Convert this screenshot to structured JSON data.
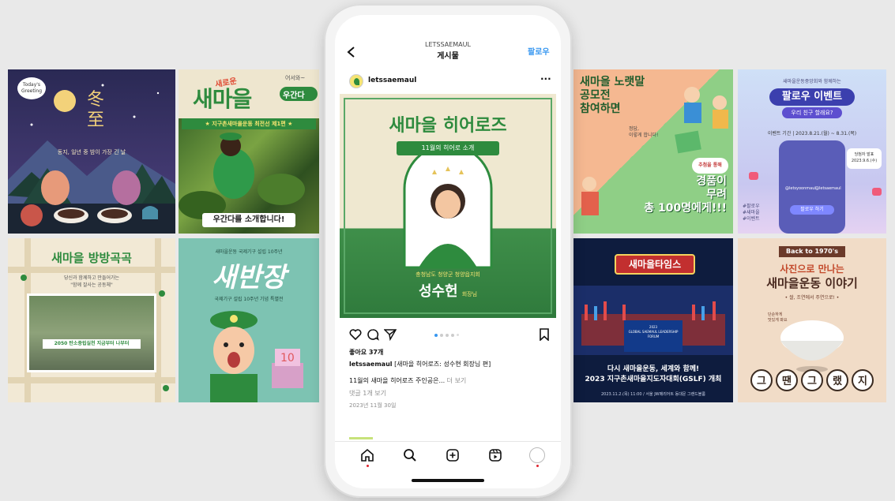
{
  "left_tiles": {
    "winter": {
      "badge": "Today's\nGreeting",
      "title": "冬\n至",
      "sub": "동지, 일년 중 밤이 가장 긴 날"
    },
    "woogan": {
      "sign": "어서와~",
      "title": "새마을",
      "badge": "우간다",
      "tag": "새로운",
      "ribbon": "★ 지구촌새마을운동 최전선 제1편 ★",
      "bottom": "우간다를 소개합니다!"
    },
    "bangbang": {
      "title": "새마을 방방곡곡",
      "sub": "당신과 함께하고 만들어가는\n\"함께 잘사는 공동체\"",
      "banner": "2050 탄소중립실천 지금부터 나부터"
    },
    "market": {
      "top": "새마을운동 국제기구 설립 10주년",
      "title": "새반장",
      "sub": "국제기구 설립 10주년 기념 특별전"
    }
  },
  "right_tiles": {
    "contest": {
      "title": "새마을 노랫말\n공모전\n참여하면",
      "sub": "정답,\n이렇게 합니다!",
      "badge": "추첨을 통해",
      "prize": "경품이\n무려\n총 100명에게!!!"
    },
    "follow": {
      "top": "새마을운동중앙회와 함께하는",
      "title": "팔로우 이벤트",
      "sub": "우리 친구 할래요?",
      "period": "이벤트 기간 | 2023.8.21.(월) ~ 8.31.(목)",
      "announce": "당첨자 발표\n2023.9.6.(수)",
      "handle1": "@letsyoonmaul",
      "handle2": "@letsaemaul",
      "follow_btn": "팔로우 하기",
      "hashtags": "#팔로우\n#새마을\n#이벤트"
    },
    "times": {
      "title": "새마을타임스",
      "forum": "2023\nGLOBAL SAEMAUL LEADERSHIP FORUM",
      "caption": "다시 새마을운동, 세계와 함께!\n2023 지구촌새마을지도자대회(GSLF) 개최",
      "date": "2023.11.2.(목) 11:00 / 서울 JW메리어트 동대문 그랜드볼룸"
    },
    "photo": {
      "badge": "Back to 1970's",
      "title1": "사진으로 만나는",
      "title2": "새마을운동 이야기",
      "sub": "• 쌀, 조연에서 주연으로! •",
      "bowl_note": "단순하게\n맛있게 봐요",
      "bottom": [
        "그",
        "땐",
        "그",
        "랬",
        "지"
      ]
    }
  },
  "phone": {
    "header": {
      "account": "LETSSAEMAUL",
      "title": "게시물",
      "follow": "팔로우",
      "back_icon": "chevron-left-icon"
    },
    "post": {
      "username": "letssaemaul",
      "image": {
        "title": "새마을 히어로즈",
        "ribbon": "11월의 히어로 소개",
        "org": "충청남도 청양군 청양읍지회",
        "name": "성수헌",
        "role": "회장님"
      },
      "likes": "좋아요 37개",
      "caption_user": "letssaemaul",
      "caption_text": "[새마을 히어로즈: 성수현 회장님 편]",
      "caption_line2": "11월의 새마을 히어로즈 주인공은...",
      "more": "더 보기",
      "comments": "댓글 1개 보기",
      "date": "2023년 11월 30일"
    },
    "nav": [
      "home-icon",
      "search-icon",
      "new-post-icon",
      "reels-icon",
      "profile-icon"
    ]
  },
  "colors": {
    "bg": "#e9e9e9",
    "ig_blue": "#3797f0",
    "green": "#2e8b3e",
    "cream": "#f3ecd6"
  }
}
